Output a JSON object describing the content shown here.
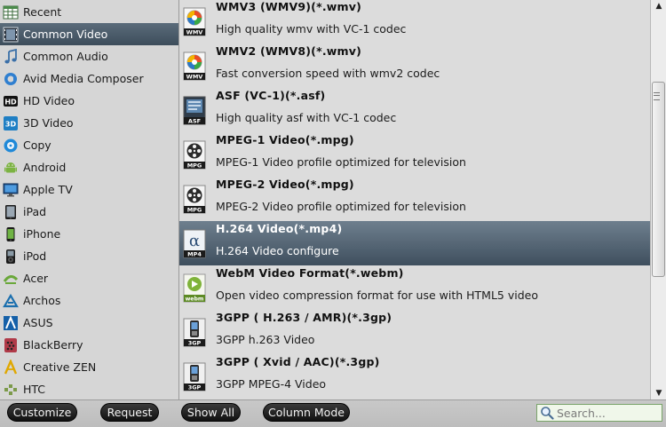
{
  "sidebar": {
    "items": [
      {
        "label": "Recent",
        "icon": "recent-grid-icon"
      },
      {
        "label": "Common Video",
        "icon": "film-strip-icon",
        "selected": true
      },
      {
        "label": "Common Audio",
        "icon": "music-note-icon"
      },
      {
        "label": "Avid Media Composer",
        "icon": "avid-icon"
      },
      {
        "label": "HD Video",
        "icon": "hd-icon"
      },
      {
        "label": "3D Video",
        "icon": "3d-icon"
      },
      {
        "label": "Copy",
        "icon": "copy-icon"
      },
      {
        "label": "Android",
        "icon": "android-icon"
      },
      {
        "label": "Apple TV",
        "icon": "apple-tv-icon"
      },
      {
        "label": "iPad",
        "icon": "ipad-icon"
      },
      {
        "label": "iPhone",
        "icon": "iphone-icon"
      },
      {
        "label": "iPod",
        "icon": "ipod-icon"
      },
      {
        "label": "Acer",
        "icon": "acer-icon"
      },
      {
        "label": "Archos",
        "icon": "archos-icon"
      },
      {
        "label": "ASUS",
        "icon": "asus-icon"
      },
      {
        "label": "BlackBerry",
        "icon": "blackberry-icon"
      },
      {
        "label": "Creative ZEN",
        "icon": "creative-zen-icon"
      },
      {
        "label": "HTC",
        "icon": "htc-icon"
      }
    ]
  },
  "formats": {
    "items": [
      {
        "title": "WMV3 (WMV9)(*.wmv)",
        "desc": "High quality wmv with VC-1 codec",
        "icon": "wmv-icon",
        "badge": "WMV"
      },
      {
        "title": "WMV2 (WMV8)(*.wmv)",
        "desc": "Fast conversion speed with wmv2 codec",
        "icon": "wmv-icon",
        "badge": "WMV"
      },
      {
        "title": "ASF (VC-1)(*.asf)",
        "desc": "High quality asf with VC-1 codec",
        "icon": "asf-icon",
        "badge": "ASF"
      },
      {
        "title": "MPEG-1 Video(*.mpg)",
        "desc": "MPEG-1 Video profile optimized for television",
        "icon": "mpg-reel-icon",
        "badge": "MPG"
      },
      {
        "title": "MPEG-2 Video(*.mpg)",
        "desc": "MPEG-2 Video profile optimized for television",
        "icon": "mpg-reel-icon",
        "badge": "MPG"
      },
      {
        "title": "H.264 Video(*.mp4)",
        "desc": "H.264 Video configure",
        "icon": "mp4-icon",
        "badge": "MP4",
        "selected": true
      },
      {
        "title": "WebM Video Format(*.webm)",
        "desc": "Open video compression format for use with HTML5 video",
        "icon": "webm-icon",
        "badge": "webm"
      },
      {
        "title": "3GPP ( H.263 / AMR)(*.3gp)",
        "desc": "3GPP h.263 Video",
        "icon": "3gp-phone-icon",
        "badge": "3GP"
      },
      {
        "title": "3GPP ( Xvid / AAC)(*.3gp)",
        "desc": "3GPP MPEG-4 Video",
        "icon": "3gp-phone-icon",
        "badge": "3GP"
      }
    ]
  },
  "toolbar": {
    "customize_label": "Customize",
    "request_label": "Request",
    "show_all_label": "Show All",
    "column_mode_label": "Column Mode",
    "search_placeholder": "Search..."
  },
  "colors": {
    "selection_dark": "#3d4d5b",
    "selection_light": "#5a6b7a",
    "search_border": "#7aa36a"
  }
}
